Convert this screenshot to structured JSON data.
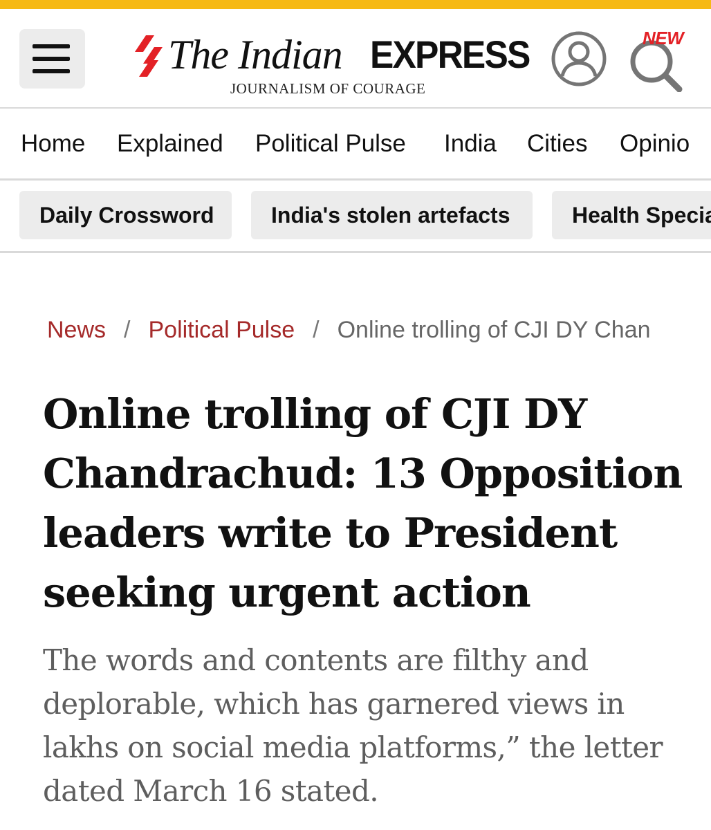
{
  "header": {
    "menu_icon": "hamburger-menu-icon",
    "logo": {
      "name_part1": "The Indian",
      "name_part2": "EXPRESS",
      "tagline": "JOURNALISM OF COURAGE"
    },
    "account_icon": "user-account-icon",
    "search_icon": "search-icon",
    "new_badge": "NEW"
  },
  "nav": {
    "items": [
      {
        "label": "Home"
      },
      {
        "label": "Explained"
      },
      {
        "label": "Political Pulse"
      },
      {
        "label": "India"
      },
      {
        "label": "Cities"
      },
      {
        "label": "Opinio"
      }
    ]
  },
  "topics": {
    "chips": [
      {
        "label": "Daily Crossword"
      },
      {
        "label": "India's stolen artefacts"
      },
      {
        "label": "Health Specia"
      }
    ]
  },
  "breadcrumb": {
    "items": [
      {
        "label": "News"
      },
      {
        "label": "Political Pulse"
      },
      {
        "label": "Online trolling of CJI DY Chan"
      }
    ],
    "separator": "/"
  },
  "article": {
    "headline": "Online trolling of CJI DY Chandrachud: 13 Opposition leaders write to President seeking urgent action",
    "dek": "The words and contents are filthy and deplorable, which has garnered views in lakhs on social media platforms,” the letter dated March 16 stated."
  },
  "colors": {
    "top_strip": "#f6b915",
    "brand_red": "#e32126",
    "breadcrumb_link": "#a52a2a",
    "chip_background": "#ececec"
  }
}
